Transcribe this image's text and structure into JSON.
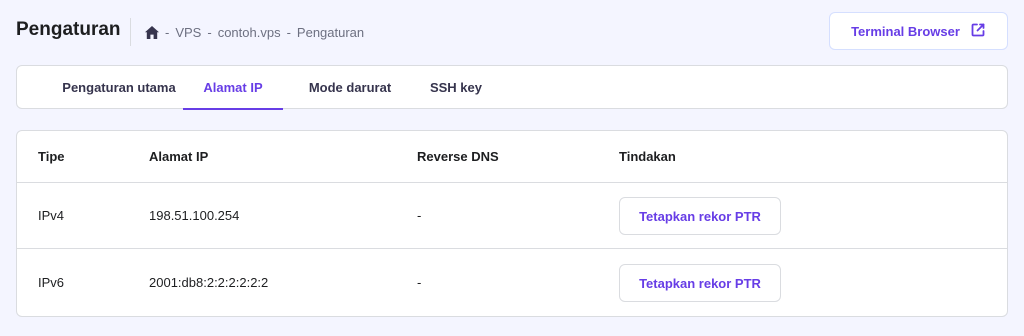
{
  "header": {
    "title": "Pengaturan",
    "breadcrumb": [
      "VPS",
      "contoh.vps",
      "Pengaturan"
    ],
    "breadcrumb_separator": "-",
    "terminal_button": "Terminal Browser"
  },
  "tabs": [
    {
      "label": "Pengaturan utama",
      "active": false
    },
    {
      "label": "Alamat IP",
      "active": true
    },
    {
      "label": "Mode darurat",
      "active": false
    },
    {
      "label": "SSH key",
      "active": false
    }
  ],
  "table": {
    "columns": [
      "Tipe",
      "Alamat IP",
      "Reverse DNS",
      "Tindakan"
    ],
    "rows": [
      {
        "type": "IPv4",
        "ip": "198.51.100.254",
        "rdns": "-",
        "action": "Tetapkan rekor PTR"
      },
      {
        "type": "IPv6",
        "ip": "2001:db8:2:2:2:2:2:2",
        "rdns": "-",
        "action": "Tetapkan rekor PTR"
      }
    ]
  },
  "colors": {
    "accent": "#673de6",
    "background": "#f4f5ff",
    "border": "#dadce0"
  },
  "icons": {
    "home": "home-icon",
    "external": "external-link-icon"
  }
}
